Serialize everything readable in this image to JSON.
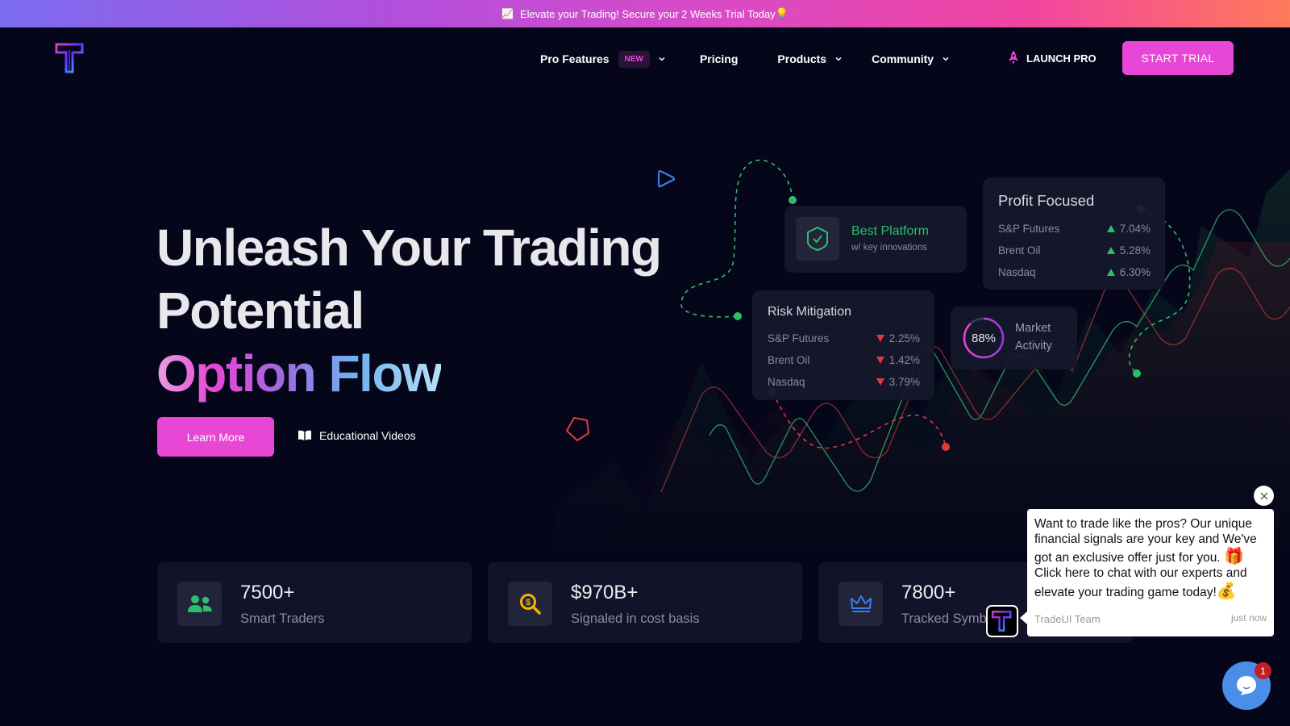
{
  "promo": {
    "emoji": "📈",
    "text": "Elevate your Trading! Secure your 2 Weeks Trial Today",
    "trail_emoji": "💡"
  },
  "nav": {
    "items": [
      {
        "label": "Pro Features",
        "badge": "NEW",
        "dropdown": true
      },
      {
        "label": "Pricing",
        "dropdown": false
      },
      {
        "label": "Products",
        "dropdown": true
      },
      {
        "label": "Community",
        "dropdown": true
      }
    ],
    "launch_label": "LAUNCH PRO",
    "cta_label": "START TRIAL"
  },
  "hero": {
    "line1": "Unleash Your Trading",
    "line2": "Potential",
    "line3": "Option Flow",
    "primary_button": "Learn More",
    "secondary_link": "Educational Videos"
  },
  "cards": {
    "best_platform": {
      "title": "Best Platform",
      "subtitle": "w/ key innovations"
    },
    "profit_focused": {
      "title": "Profit Focused",
      "rows": [
        {
          "name": "S&P Futures",
          "value": "7.04%",
          "direction": "up"
        },
        {
          "name": "Brent Oil",
          "value": "5.28%",
          "direction": "up"
        },
        {
          "name": "Nasdaq",
          "value": "6.30%",
          "direction": "up"
        }
      ]
    },
    "risk_mitigation": {
      "title": "Risk Mitigation",
      "rows": [
        {
          "name": "S&P Futures",
          "value": "2.25%",
          "direction": "down"
        },
        {
          "name": "Brent Oil",
          "value": "1.42%",
          "direction": "down"
        },
        {
          "name": "Nasdaq",
          "value": "3.79%",
          "direction": "down"
        }
      ]
    },
    "market_activity": {
      "percent_label": "88%",
      "percent": 88,
      "label_line1": "Market",
      "label_line2": "Activity"
    }
  },
  "stats": [
    {
      "icon": "users-icon",
      "value": "7500+",
      "label": "Smart Traders"
    },
    {
      "icon": "dollar-search-icon",
      "value": "$970B+",
      "label": "Signaled in cost basis"
    },
    {
      "icon": "crown-icon",
      "value": "7800+",
      "label": "Tracked Symbols"
    }
  ],
  "chat": {
    "message_part1": "Want to trade like the pros? Our unique financial signals are your key and We've got an exclusive offer just for you.",
    "emoji1": "🎁",
    "message_part2": "Click here to chat with our experts and elevate your trading game today!",
    "emoji2": "💰",
    "sender": "TradeUI Team",
    "time": "just now",
    "unread_count": "1"
  },
  "colors": {
    "accent": "#e847d5",
    "up": "#2ebd6b",
    "down": "#e0393e",
    "background": "#05061a",
    "chat_launcher": "#4a8ee8"
  }
}
